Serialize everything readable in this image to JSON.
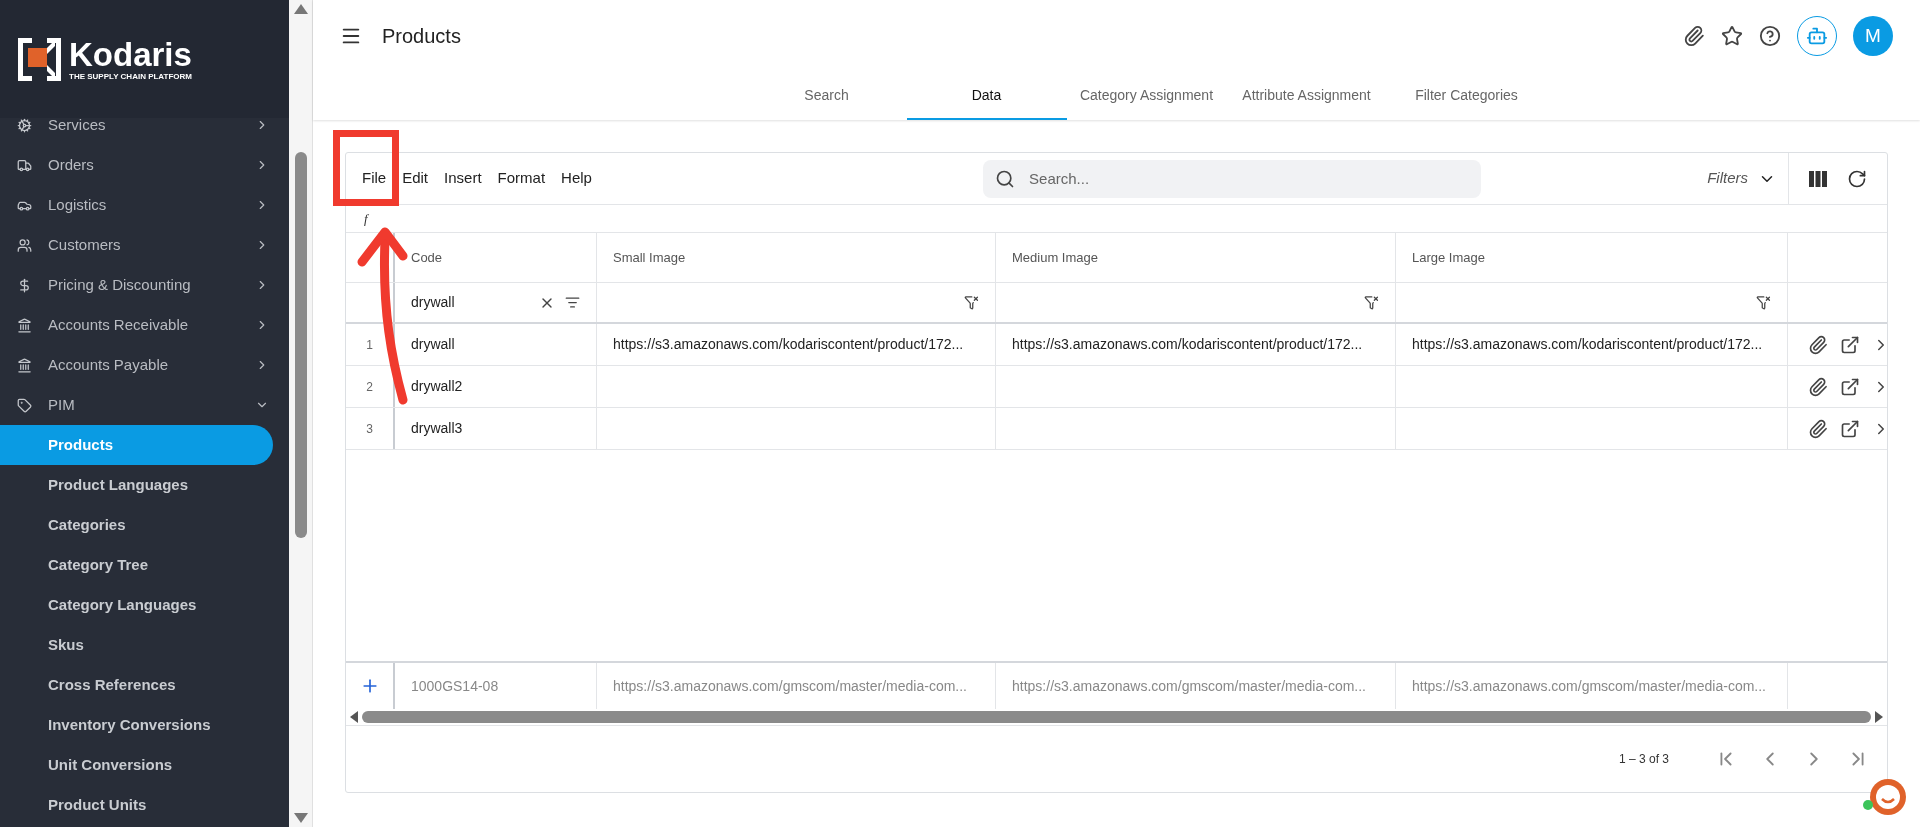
{
  "brand": {
    "name": "Kodaris",
    "tagline": "THE SUPPLY CHAIN PLATFORM"
  },
  "sidebar": {
    "items": [
      {
        "label": "Services",
        "kind": "gears",
        "expanded": false
      },
      {
        "label": "Orders",
        "kind": "truck",
        "expanded": false
      },
      {
        "label": "Logistics",
        "kind": "car",
        "expanded": false
      },
      {
        "label": "Customers",
        "kind": "users",
        "expanded": false
      },
      {
        "label": "Pricing & Discounting",
        "kind": "dollar",
        "expanded": false
      },
      {
        "label": "Accounts Receivable",
        "kind": "bank",
        "expanded": false
      },
      {
        "label": "Accounts Payable",
        "kind": "bank",
        "expanded": false
      },
      {
        "label": "PIM",
        "kind": "tag",
        "expanded": true,
        "children": [
          {
            "label": "Products",
            "selected": true
          },
          {
            "label": "Product Languages",
            "selected": false
          },
          {
            "label": "Categories",
            "selected": false
          },
          {
            "label": "Category Tree",
            "selected": false
          },
          {
            "label": "Category Languages",
            "selected": false
          },
          {
            "label": "Skus",
            "selected": false
          },
          {
            "label": "Cross References",
            "selected": false
          },
          {
            "label": "Inventory Conversions",
            "selected": false
          },
          {
            "label": "Unit Conversions",
            "selected": false
          },
          {
            "label": "Product Units",
            "selected": false
          }
        ]
      }
    ]
  },
  "header": {
    "title": "Products",
    "avatar": "M"
  },
  "tabs": [
    {
      "label": "Search",
      "selected": false
    },
    {
      "label": "Data",
      "selected": true
    },
    {
      "label": "Category Assignment",
      "selected": false
    },
    {
      "label": "Attribute Assignment",
      "selected": false
    },
    {
      "label": "Filter Categories",
      "selected": false
    }
  ],
  "toolbar": {
    "menu": [
      "File",
      "Edit",
      "Insert",
      "Format",
      "Help"
    ],
    "search": {
      "placeholder": "Search..."
    },
    "filters": "Filters"
  },
  "formula_bar": {
    "label": "f"
  },
  "table": {
    "columns": [
      "Code",
      "Small Image",
      "Medium Image",
      "Large Image"
    ],
    "filters": [
      {
        "value": "drywall",
        "active": true
      },
      {
        "active": false
      },
      {
        "active": false
      },
      {
        "active": false
      }
    ],
    "rows": [
      {
        "number": "1",
        "cells": [
          "drywall",
          "https://s3.amazonaws.com/kodariscontent/product/172...",
          "https://s3.amazonaws.com/kodariscontent/product/172...",
          "https://s3.amazonaws.com/kodariscontent/product/172..."
        ]
      },
      {
        "number": "2",
        "cells": [
          "drywall2",
          "",
          "",
          ""
        ]
      },
      {
        "number": "3",
        "cells": [
          "drywall3",
          "",
          "",
          ""
        ]
      }
    ],
    "new_row": [
      "1000GS14-08",
      "https://s3.amazonaws.com/gmscom/master/media-com...",
      "https://s3.amazonaws.com/gmscom/master/media-com...",
      "https://s3.amazonaws.com/gmscom/master/media-com..."
    ]
  },
  "pagination": {
    "range": "1 – 3 of 3"
  }
}
